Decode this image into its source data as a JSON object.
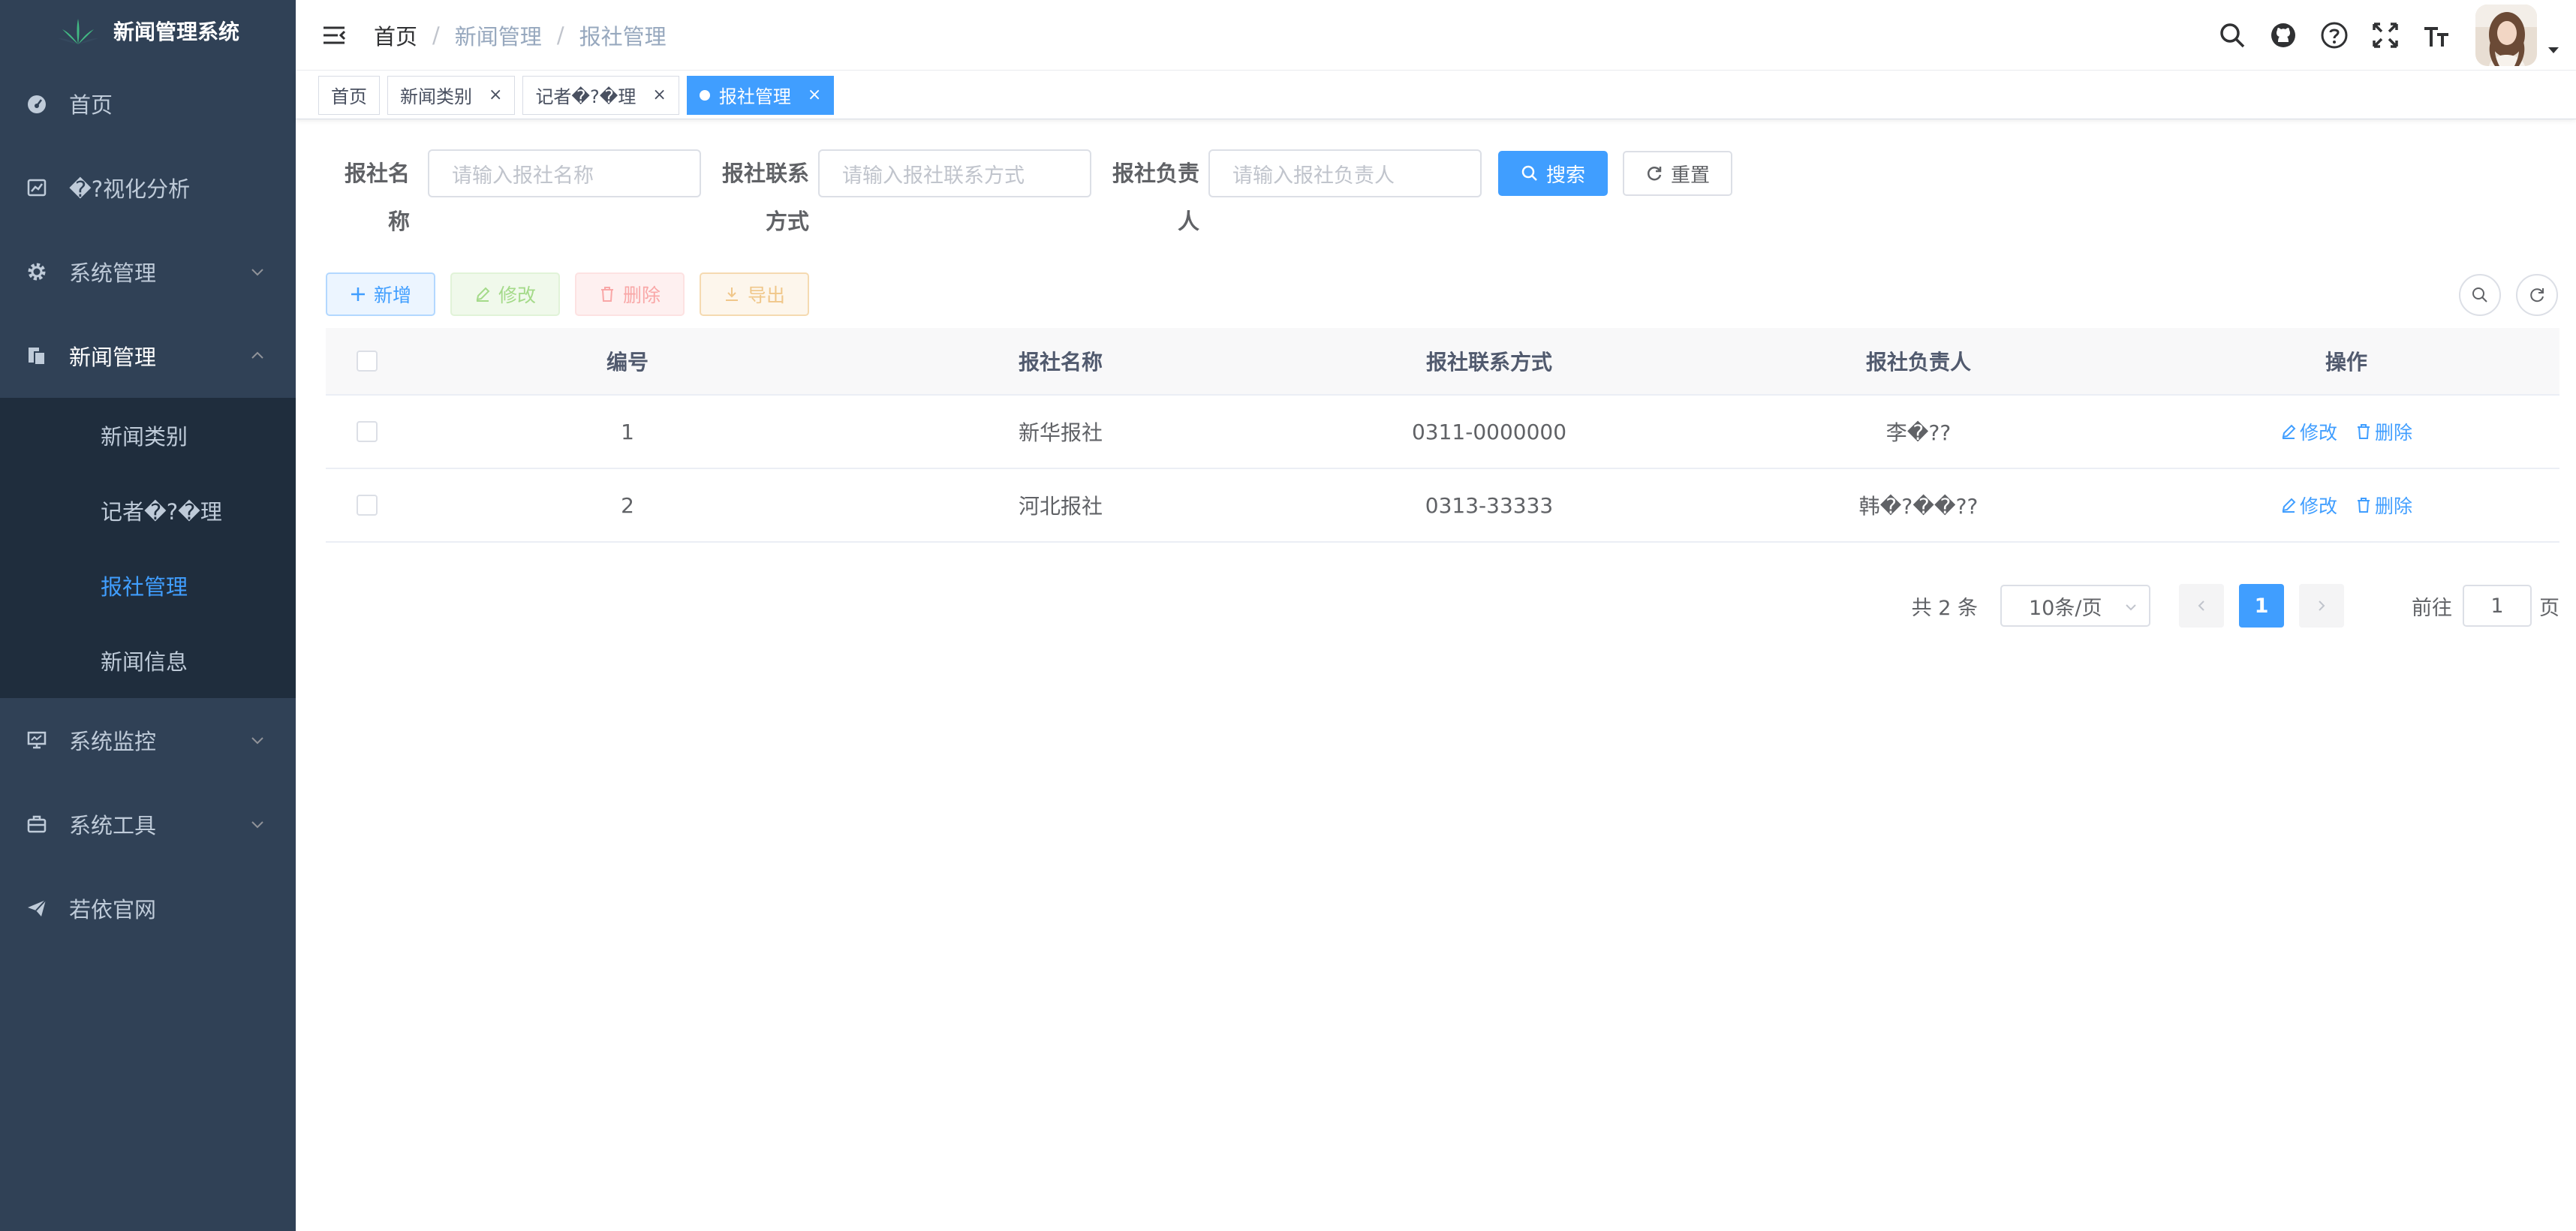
{
  "app": {
    "title": "新闻管理系统"
  },
  "sidebar": {
    "items": [
      {
        "label": "首页",
        "icon": "dashboard-icon"
      },
      {
        "label": "�?视化分析",
        "icon": "chart-icon"
      },
      {
        "label": "系统管理",
        "icon": "gear-icon",
        "expandable": true
      },
      {
        "label": "新闻管理",
        "icon": "document-icon",
        "expanded": true,
        "children": [
          {
            "label": "新闻类别"
          },
          {
            "label": "记者�?�理"
          },
          {
            "label": "报社管理",
            "active": true
          },
          {
            "label": "新闻信息"
          }
        ]
      },
      {
        "label": "系统监控",
        "icon": "monitor-icon",
        "expandable": true
      },
      {
        "label": "系统工具",
        "icon": "toolbox-icon",
        "expandable": true
      },
      {
        "label": "若依官网",
        "icon": "send-icon"
      }
    ]
  },
  "header": {
    "breadcrumb": [
      "首页",
      "新闻管理",
      "报社管理"
    ],
    "separator": "/"
  },
  "tags": [
    {
      "label": "首页",
      "closable": false
    },
    {
      "label": "新闻类别",
      "closable": true
    },
    {
      "label": "记者�?�理",
      "closable": true
    },
    {
      "label": "报社管理",
      "closable": true,
      "active": true
    }
  ],
  "tag_close": "×",
  "search": {
    "fields": [
      {
        "label_line1": "报社名称",
        "label_line2": "",
        "placeholder": "请输入报社名称"
      },
      {
        "label_line1": "报社联系",
        "label_line2": "方式",
        "placeholder": "请输入报社联系方式"
      },
      {
        "label_line1": "报社负责",
        "label_line2": "人",
        "placeholder": "请输入报社负责人"
      }
    ],
    "search_label": "搜索",
    "reset_label": "重置"
  },
  "toolbar": {
    "add_label": "新增",
    "edit_label": "修改",
    "delete_label": "删除",
    "export_label": "导出"
  },
  "table": {
    "columns": [
      "编号",
      "报社名称",
      "报社联系方式",
      "报社负责人",
      "操作"
    ],
    "rows": [
      {
        "id": "1",
        "name": "新华报社",
        "phone": "0311-0000000",
        "leader": "李�??"
      },
      {
        "id": "2",
        "name": "河北报社",
        "phone": "0313-33333",
        "leader": "韩�?��??"
      }
    ],
    "row_edit_label": "修改",
    "row_delete_label": "删除"
  },
  "pagination": {
    "total_text": "共 2 条",
    "page_size": "10条/页",
    "current_page": "1",
    "goto_prefix": "前往",
    "goto_value": "1",
    "goto_suffix": "页"
  },
  "colors": {
    "sidebar_bg": "#304156",
    "submenu_bg": "#1f2d3d",
    "primary": "#409eff"
  }
}
